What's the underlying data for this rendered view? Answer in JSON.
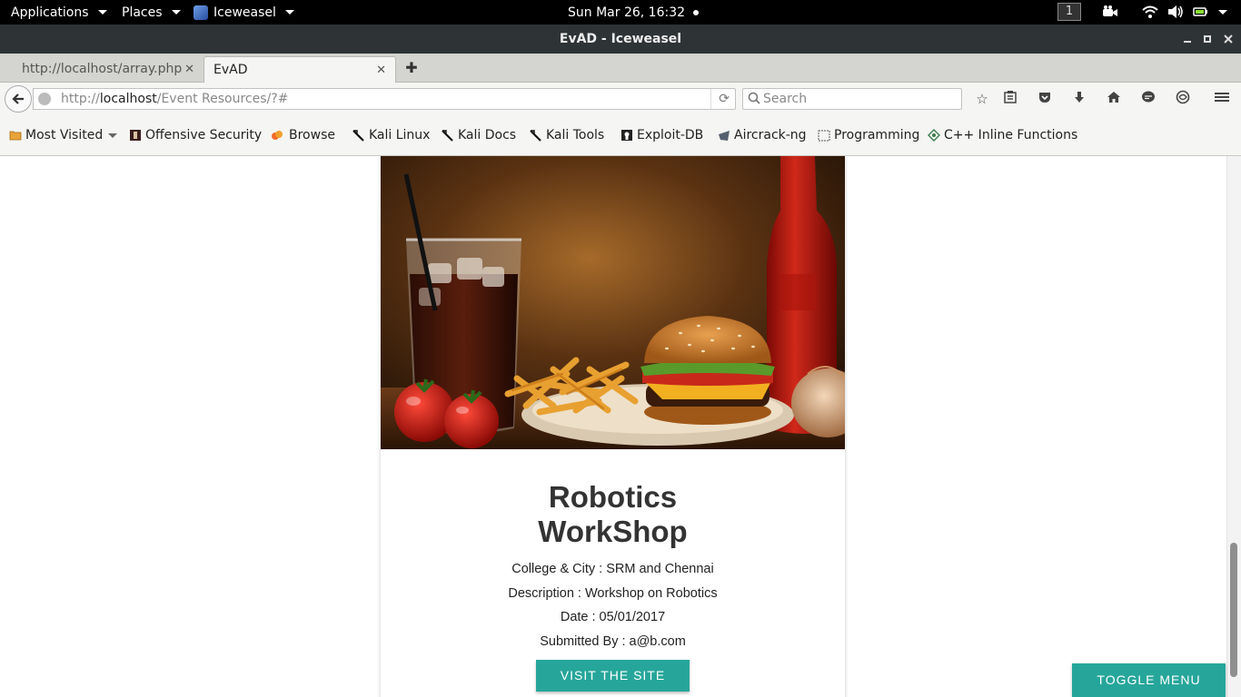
{
  "topbar": {
    "applications": "Applications",
    "places": "Places",
    "browser": "Iceweasel",
    "clock": "Sun Mar 26, 16:32",
    "workspace": "1"
  },
  "window": {
    "title": "EvAD - Iceweasel"
  },
  "tabs": [
    {
      "label": "http://localhost/array.php",
      "active": false
    },
    {
      "label": "EvAD",
      "active": true
    }
  ],
  "navbar": {
    "url_prefix": "http://",
    "url_host": "localhost",
    "url_path": "/Event Resources/?#",
    "search_placeholder": "Search"
  },
  "bookmarks": [
    {
      "label": "Most Visited",
      "icon": "folder-icon"
    },
    {
      "label": "Offensive Security",
      "icon": "offsec-icon"
    },
    {
      "label": "Browse",
      "icon": "browse-icon"
    },
    {
      "label": "Kali Linux",
      "icon": "kali-icon"
    },
    {
      "label": "Kali Docs",
      "icon": "kali-icon"
    },
    {
      "label": "Kali Tools",
      "icon": "kali-icon"
    },
    {
      "label": "Exploit-DB",
      "icon": "exploitdb-icon"
    },
    {
      "label": "Aircrack-ng",
      "icon": "aircrack-icon"
    },
    {
      "label": "Programming",
      "icon": "folder-outline-icon"
    },
    {
      "label": "C++ Inline Functions",
      "icon": "cpp-icon"
    }
  ],
  "event": {
    "title_line1": "Robotics",
    "title_line2": "WorkShop",
    "college_city": "College & City : SRM and Chennai",
    "description": "Description : Workshop on Robotics",
    "date": "Date : 05/01/2017",
    "submitted_by": "Submitted By : a@b.com",
    "visit_label": "VISIT THE SITE"
  },
  "toggle_menu_label": "TOGGLE MENU",
  "colors": {
    "accent": "#26a69a",
    "titlebar": "#2e3436",
    "topbar": "#000000"
  }
}
